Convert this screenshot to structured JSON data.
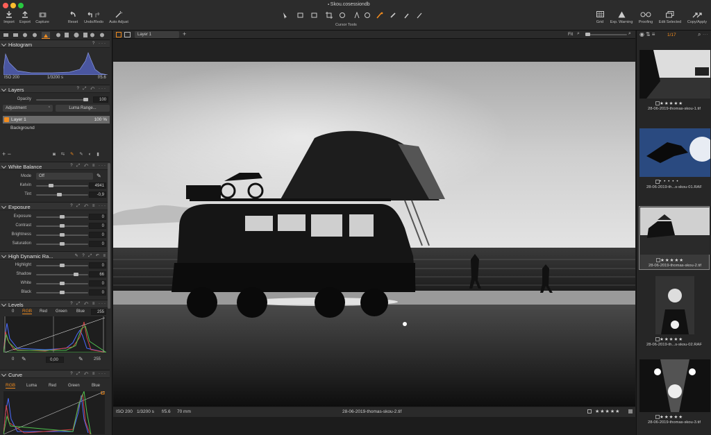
{
  "window": {
    "title": "Skou.cosessiondb"
  },
  "toolbar": {
    "left": [
      {
        "label": "Import",
        "icon": "import-icon"
      },
      {
        "label": "Export",
        "icon": "export-icon"
      },
      {
        "label": "Capture",
        "icon": "camera-icon"
      },
      {
        "label": "Reset",
        "icon": "reset-icon"
      },
      {
        "label": "Undo/Redo",
        "icon": "undo-icon"
      },
      {
        "label": "Auto Adjust",
        "icon": "magic-wand-icon"
      }
    ],
    "center_label": "Cursor Tools",
    "right": [
      {
        "label": "Grid",
        "icon": "grid-icon"
      },
      {
        "label": "Exp. Warning",
        "icon": "warning-icon"
      },
      {
        "label": "Proofing",
        "icon": "glasses-icon"
      },
      {
        "label": "Edit Selected",
        "icon": "edit-selected-icon"
      },
      {
        "label": "Copy/Apply",
        "icon": "copy-apply-icon"
      }
    ]
  },
  "histogram": {
    "title": "Histogram",
    "iso": "ISO 200",
    "shutter": "1/3200 s",
    "aperture": "f/5.6"
  },
  "layers": {
    "title": "Layers",
    "opacity_label": "Opacity",
    "opacity_value": "100",
    "adjustment_label": "Adjustment",
    "luma_range_label": "Luma Range...",
    "items": [
      {
        "name": "Layer 1",
        "value": "100 %"
      },
      {
        "name": "Background"
      }
    ]
  },
  "white_balance": {
    "title": "White Balance",
    "mode_label": "Mode",
    "mode_value": "Off",
    "kelvin_label": "Kelvin",
    "kelvin_value": "4941",
    "tint_label": "Tint",
    "tint_value": "-0,9"
  },
  "exposure": {
    "title": "Exposure",
    "rows": [
      {
        "label": "Exposure",
        "value": "0"
      },
      {
        "label": "Contrast",
        "value": "0"
      },
      {
        "label": "Brightness",
        "value": "0"
      },
      {
        "label": "Saturation",
        "value": "0"
      }
    ]
  },
  "hdr": {
    "title": "High Dynamic Ra...",
    "rows": [
      {
        "label": "Highlight",
        "value": "0"
      },
      {
        "label": "Shadow",
        "value": "66"
      },
      {
        "label": "White",
        "value": "0"
      },
      {
        "label": "Black",
        "value": "0"
      }
    ]
  },
  "levels": {
    "title": "Levels",
    "tabs": [
      "RGB",
      "Red",
      "Green",
      "Blue"
    ],
    "in_low": "0",
    "in_high": "255",
    "out_low": "0",
    "mid": "0,00",
    "out_high": "255"
  },
  "curve": {
    "title": "Curve",
    "tabs": [
      "RGB",
      "Luma",
      "Red",
      "Green",
      "Blue"
    ]
  },
  "viewer": {
    "layer_select": "Layer 1",
    "zoom_label": "Fit"
  },
  "footer": {
    "iso": "ISO 200",
    "shutter": "1/3200 s",
    "aperture": "f/5.6",
    "focal": "70 mm",
    "filename": "28-06-2019-thomas-skou-2.tif",
    "stars": "★★★★★"
  },
  "browser": {
    "counter": "1/17",
    "thumbs": [
      {
        "name": "28-06-2019-thomas-skou-1.tif",
        "stars": "★★★★★"
      },
      {
        "name": "28-06-2019-th...s-skou-01.RAF",
        "stars": "• • • • •"
      },
      {
        "name": "28-06-2019-thomas-skou-2.tif",
        "stars": "★★★★★"
      },
      {
        "name": "28-06-2019-th...s-skou-02.RAF",
        "stars": "★★★★★"
      },
      {
        "name": "28-06-2019-thomas-skou-3.tif",
        "stars": "★★★★★"
      }
    ]
  },
  "colors": {
    "accent": "#f28c1e",
    "bg": "#1c1c1c",
    "panel": "#2a2a2a"
  }
}
